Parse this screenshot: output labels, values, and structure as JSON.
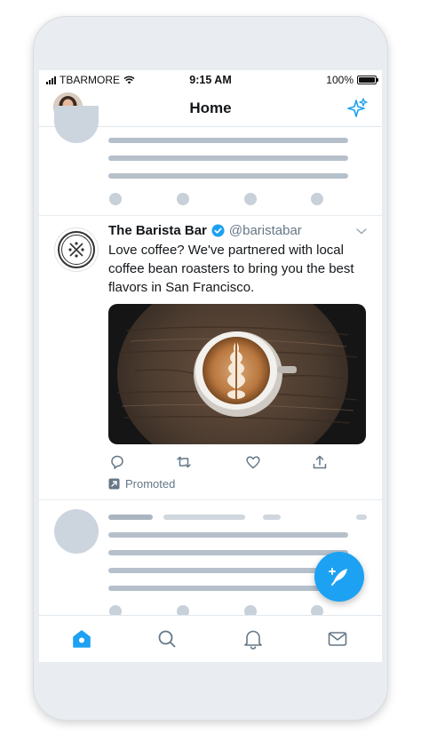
{
  "status_bar": {
    "carrier": "TBARMORE",
    "time": "9:15 AM",
    "battery_percent": "100%",
    "battery_level": 1.0
  },
  "nav": {
    "title": "Home",
    "left_icon": "profile-avatar",
    "right_icon": "sparkle-icon"
  },
  "tweet": {
    "name": "The Barista Bar",
    "handle": "@baristabar",
    "verified": true,
    "text": "Love coffee? We've partnered with local coffee bean roasters to bring you the best flavors in San Francisco.",
    "media": "latte-art-photo",
    "actions": [
      "reply-icon",
      "retweet-icon",
      "like-icon",
      "share-icon"
    ],
    "promoted_label": "Promoted"
  },
  "fab": {
    "icon": "compose-tweet-icon"
  },
  "tab_bar": {
    "tabs": [
      "home-icon",
      "search-icon",
      "notifications-icon",
      "messages-icon"
    ],
    "active": "home-icon"
  },
  "colors": {
    "accent": "#1da1f2",
    "skeleton": "#b6c0cb",
    "text_primary": "#14171a",
    "text_secondary": "#657786"
  }
}
